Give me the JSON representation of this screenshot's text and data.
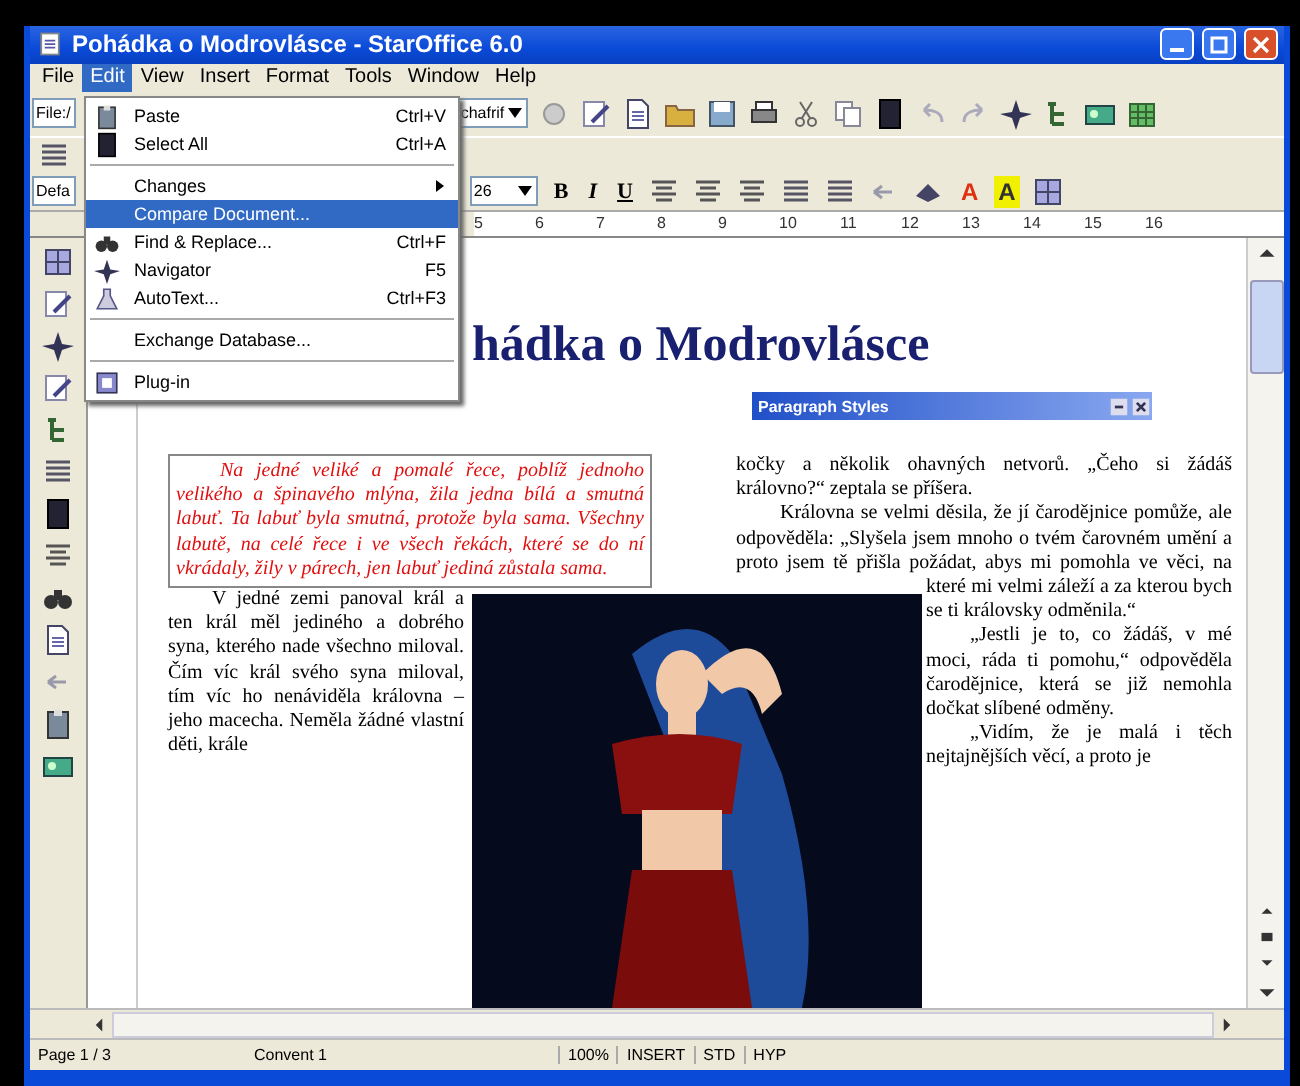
{
  "window": {
    "title": "Pohádka o Modrovlásce - StarOffice 6.0"
  },
  "menu_bar": [
    {
      "label": "File",
      "selected": false
    },
    {
      "label": "Edit",
      "selected": true
    },
    {
      "label": "View",
      "selected": false
    },
    {
      "label": "Insert",
      "selected": false
    },
    {
      "label": "Format",
      "selected": false
    },
    {
      "label": "Tools",
      "selected": false
    },
    {
      "label": "Window",
      "selected": false
    },
    {
      "label": "Help",
      "selected": false
    }
  ],
  "edit_menu": {
    "items": [
      {
        "kind": "item",
        "label": "Paste",
        "shortcut": "Ctrl+V",
        "has_icon": true,
        "selected": false
      },
      {
        "kind": "item",
        "label": "Select All",
        "shortcut": "Ctrl+A",
        "has_icon": true,
        "selected": false
      },
      {
        "kind": "separator"
      },
      {
        "kind": "submenu",
        "label": "Changes",
        "has_icon": false,
        "selected": false
      },
      {
        "kind": "item",
        "label": "Compare Document...",
        "has_icon": false,
        "selected": true
      },
      {
        "kind": "item",
        "label": "Find & Replace...",
        "shortcut": "Ctrl+F",
        "has_icon": true,
        "selected": false
      },
      {
        "kind": "item",
        "label": "Navigator",
        "shortcut": "F5",
        "has_icon": true,
        "selected": false
      },
      {
        "kind": "item",
        "label": "AutoText...",
        "shortcut": "Ctrl+F3",
        "has_icon": true,
        "selected": false
      },
      {
        "kind": "separator"
      },
      {
        "kind": "item",
        "label": "Exchange Database...",
        "has_icon": false,
        "selected": false
      },
      {
        "kind": "separator"
      },
      {
        "kind": "item",
        "label": "Plug-in",
        "has_icon": true,
        "selected": false
      }
    ]
  },
  "function_bar": {
    "url_field": "File:/",
    "load_field": "chafrif"
  },
  "object_bar": {
    "style_field": "Defa",
    "size_field": "26",
    "format_buttons": [
      "B",
      "I",
      "U"
    ],
    "color_buttons": [
      {
        "label": "A",
        "color": "#e03010"
      },
      {
        "label": "A",
        "color": "#f0f000"
      }
    ]
  },
  "ruler": {
    "numbers": [
      "5",
      "6",
      "7",
      "8",
      "9",
      "10",
      "11",
      "12",
      "13",
      "14",
      "15",
      "16"
    ]
  },
  "paragraph_styles": {
    "title": "Paragraph Styles"
  },
  "document": {
    "heading": "hádka o Modrovlásce",
    "quote": "Na jedné veliké a pomalé řece, poblíž jednoho velikého a špinavého mlýna, žila jedna bílá a smutná labuť. Ta labuť byla smutná, protože byla sama. Všechny labutě, na celé řece i ve všech řekách, které se do ní vkrádaly, žily v párech, jen labuť jediná zůstala sama.",
    "left_paragraphs": [
      "V jedné zemi panoval král a ten král měl jediného a dobrého syna, kterého nade všechno miloval. Čím víc král svého syna miloval, tím víc ho nenáviděla královna – jeho macecha. Neměla žádné vlastní děti, krále"
    ],
    "right_paragraphs": [
      {
        "text": "kočky a několik ohavných netvorů. „Čeho si žádáš královno?“ zeptala se příšera.",
        "indent": false
      },
      {
        "text": "Královna se velmi děsila, že jí čarodějnice pomůže, ale odpověděla: „Slyšela jsem mnoho o tvém čarovném umění a proto jsem tě přišla požádat, abys mi pomohla ve věci, na které mi velmi záleží a za kterou bych se ti královsky odměnila.“",
        "indent": true
      },
      {
        "text": "„Jestli je to, co žádáš, v mé moci, ráda ti pomohu,“ odpověděla čarodějnice, která se již nemohla dočkat slíbené odměny.",
        "indent": true
      },
      {
        "text": "„Vidím, že je malá i těch nejtajnějších věcí, a proto je",
        "indent": true
      }
    ]
  },
  "status_bar": {
    "page": "Page 1 / 3",
    "page_style": "Convent 1",
    "zoom": "100%",
    "insert_mode": "INSERT",
    "selection_mode": "STD",
    "hyperlink_mode": "HYP"
  }
}
